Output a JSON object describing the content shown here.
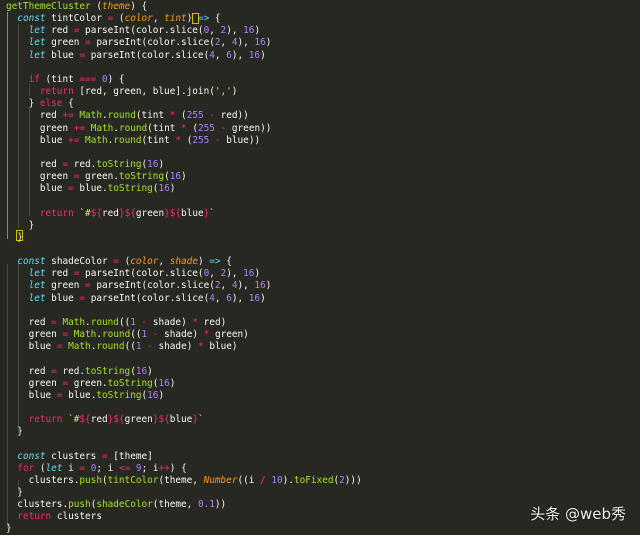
{
  "watermark": {
    "text": "头条 @web秀"
  },
  "code_lines": [
    [
      {
        "t": "fn",
        "v": "getThemeCluster"
      },
      {
        "t": "pun",
        "v": " ("
      },
      {
        "t": "par",
        "v": "theme"
      },
      {
        "t": "pun",
        "v": ") {"
      }
    ],
    [
      {
        "t": "sp",
        "v": "  "
      },
      {
        "t": "kw",
        "v": "const"
      },
      {
        "t": "var",
        "v": " tintColor "
      },
      {
        "t": "op",
        "v": "="
      },
      {
        "t": "pun",
        "v": " ("
      },
      {
        "t": "par",
        "v": "color"
      },
      {
        "t": "pun",
        "v": ", "
      },
      {
        "t": "par",
        "v": "tint"
      },
      {
        "t": "pun",
        "v": ") "
      },
      {
        "t": "kw",
        "v": "=>"
      },
      {
        "t": "pun",
        "v": " {"
      }
    ],
    [
      {
        "t": "sp",
        "v": "    "
      },
      {
        "t": "kw",
        "v": "let"
      },
      {
        "t": "var",
        "v": " red "
      },
      {
        "t": "op",
        "v": "="
      },
      {
        "t": "var",
        "v": " parseInt(color.slice("
      },
      {
        "t": "num",
        "v": "0"
      },
      {
        "t": "pun",
        "v": ", "
      },
      {
        "t": "num",
        "v": "2"
      },
      {
        "t": "pun",
        "v": "), "
      },
      {
        "t": "num",
        "v": "16"
      },
      {
        "t": "pun",
        "v": ")"
      }
    ],
    [
      {
        "t": "sp",
        "v": "    "
      },
      {
        "t": "kw",
        "v": "let"
      },
      {
        "t": "var",
        "v": " green "
      },
      {
        "t": "op",
        "v": "="
      },
      {
        "t": "var",
        "v": " parseInt(color.slice("
      },
      {
        "t": "num",
        "v": "2"
      },
      {
        "t": "pun",
        "v": ", "
      },
      {
        "t": "num",
        "v": "4"
      },
      {
        "t": "pun",
        "v": "), "
      },
      {
        "t": "num",
        "v": "16"
      },
      {
        "t": "pun",
        "v": ")"
      }
    ],
    [
      {
        "t": "sp",
        "v": "    "
      },
      {
        "t": "kw",
        "v": "let"
      },
      {
        "t": "var",
        "v": " blue "
      },
      {
        "t": "op",
        "v": "="
      },
      {
        "t": "var",
        "v": " parseInt(color.slice("
      },
      {
        "t": "num",
        "v": "4"
      },
      {
        "t": "pun",
        "v": ", "
      },
      {
        "t": "num",
        "v": "6"
      },
      {
        "t": "pun",
        "v": "), "
      },
      {
        "t": "num",
        "v": "16"
      },
      {
        "t": "pun",
        "v": ")"
      }
    ],
    [],
    [
      {
        "t": "sp",
        "v": "    "
      },
      {
        "t": "ct",
        "v": "if"
      },
      {
        "t": "pun",
        "v": " (tint "
      },
      {
        "t": "op",
        "v": "==="
      },
      {
        "t": "pun",
        "v": " "
      },
      {
        "t": "num",
        "v": "0"
      },
      {
        "t": "pun",
        "v": ") {"
      }
    ],
    [
      {
        "t": "sp",
        "v": "      "
      },
      {
        "t": "ct",
        "v": "return"
      },
      {
        "t": "pun",
        "v": " [red, green, blue].join("
      },
      {
        "t": "str",
        "v": "','"
      },
      {
        "t": "pun",
        "v": ")"
      }
    ],
    [
      {
        "t": "sp",
        "v": "    "
      },
      {
        "t": "pun",
        "v": "} "
      },
      {
        "t": "ct",
        "v": "else"
      },
      {
        "t": "pun",
        "v": " {"
      }
    ],
    [
      {
        "t": "sp",
        "v": "      "
      },
      {
        "t": "var",
        "v": "red "
      },
      {
        "t": "op",
        "v": "+="
      },
      {
        "t": "fn",
        "v": " Math"
      },
      {
        "t": "pun",
        "v": "."
      },
      {
        "t": "fn",
        "v": "round"
      },
      {
        "t": "pun",
        "v": "(tint "
      },
      {
        "t": "op",
        "v": "*"
      },
      {
        "t": "pun",
        "v": " ("
      },
      {
        "t": "num",
        "v": "255"
      },
      {
        "t": "pun",
        "v": " "
      },
      {
        "t": "op",
        "v": "-"
      },
      {
        "t": "pun",
        "v": " red))"
      }
    ],
    [
      {
        "t": "sp",
        "v": "      "
      },
      {
        "t": "var",
        "v": "green "
      },
      {
        "t": "op",
        "v": "+="
      },
      {
        "t": "fn",
        "v": " Math"
      },
      {
        "t": "pun",
        "v": "."
      },
      {
        "t": "fn",
        "v": "round"
      },
      {
        "t": "pun",
        "v": "(tint "
      },
      {
        "t": "op",
        "v": "*"
      },
      {
        "t": "pun",
        "v": " ("
      },
      {
        "t": "num",
        "v": "255"
      },
      {
        "t": "pun",
        "v": " "
      },
      {
        "t": "op",
        "v": "-"
      },
      {
        "t": "pun",
        "v": " green))"
      }
    ],
    [
      {
        "t": "sp",
        "v": "      "
      },
      {
        "t": "var",
        "v": "blue "
      },
      {
        "t": "op",
        "v": "+="
      },
      {
        "t": "fn",
        "v": " Math"
      },
      {
        "t": "pun",
        "v": "."
      },
      {
        "t": "fn",
        "v": "round"
      },
      {
        "t": "pun",
        "v": "(tint "
      },
      {
        "t": "op",
        "v": "*"
      },
      {
        "t": "pun",
        "v": " ("
      },
      {
        "t": "num",
        "v": "255"
      },
      {
        "t": "pun",
        "v": " "
      },
      {
        "t": "op",
        "v": "-"
      },
      {
        "t": "pun",
        "v": " blue))"
      }
    ],
    [],
    [
      {
        "t": "sp",
        "v": "      "
      },
      {
        "t": "var",
        "v": "red "
      },
      {
        "t": "op",
        "v": "="
      },
      {
        "t": "pun",
        "v": " red."
      },
      {
        "t": "fn",
        "v": "toString"
      },
      {
        "t": "pun",
        "v": "("
      },
      {
        "t": "num",
        "v": "16"
      },
      {
        "t": "pun",
        "v": ")"
      }
    ],
    [
      {
        "t": "sp",
        "v": "      "
      },
      {
        "t": "var",
        "v": "green "
      },
      {
        "t": "op",
        "v": "="
      },
      {
        "t": "pun",
        "v": " green."
      },
      {
        "t": "fn",
        "v": "toString"
      },
      {
        "t": "pun",
        "v": "("
      },
      {
        "t": "num",
        "v": "16"
      },
      {
        "t": "pun",
        "v": ")"
      }
    ],
    [
      {
        "t": "sp",
        "v": "      "
      },
      {
        "t": "var",
        "v": "blue "
      },
      {
        "t": "op",
        "v": "="
      },
      {
        "t": "pun",
        "v": " blue."
      },
      {
        "t": "fn",
        "v": "toString"
      },
      {
        "t": "pun",
        "v": "("
      },
      {
        "t": "num",
        "v": "16"
      },
      {
        "t": "pun",
        "v": ")"
      }
    ],
    [],
    [
      {
        "t": "sp",
        "v": "      "
      },
      {
        "t": "ct",
        "v": "return"
      },
      {
        "t": "pun",
        "v": " "
      },
      {
        "t": "tpl",
        "v": "`#"
      },
      {
        "t": "tpi",
        "v": "${"
      },
      {
        "t": "var",
        "v": "red"
      },
      {
        "t": "tpi",
        "v": "}${"
      },
      {
        "t": "var",
        "v": "green"
      },
      {
        "t": "tpi",
        "v": "}${"
      },
      {
        "t": "var",
        "v": "blue"
      },
      {
        "t": "tpi",
        "v": "}"
      },
      {
        "t": "tpl",
        "v": "`"
      }
    ],
    [
      {
        "t": "sp",
        "v": "    "
      },
      {
        "t": "pun",
        "v": "}"
      }
    ],
    [
      {
        "t": "sp",
        "v": "  "
      },
      {
        "t": "pun",
        "v": "}"
      }
    ],
    [],
    [
      {
        "t": "sp",
        "v": "  "
      },
      {
        "t": "kw",
        "v": "const"
      },
      {
        "t": "var",
        "v": " shadeColor "
      },
      {
        "t": "op",
        "v": "="
      },
      {
        "t": "pun",
        "v": " ("
      },
      {
        "t": "par",
        "v": "color"
      },
      {
        "t": "pun",
        "v": ", "
      },
      {
        "t": "par",
        "v": "shade"
      },
      {
        "t": "pun",
        "v": ") "
      },
      {
        "t": "kw",
        "v": "=>"
      },
      {
        "t": "pun",
        "v": " {"
      }
    ],
    [
      {
        "t": "sp",
        "v": "    "
      },
      {
        "t": "kw",
        "v": "let"
      },
      {
        "t": "var",
        "v": " red "
      },
      {
        "t": "op",
        "v": "="
      },
      {
        "t": "var",
        "v": " parseInt(color.slice("
      },
      {
        "t": "num",
        "v": "0"
      },
      {
        "t": "pun",
        "v": ", "
      },
      {
        "t": "num",
        "v": "2"
      },
      {
        "t": "pun",
        "v": "), "
      },
      {
        "t": "num",
        "v": "16"
      },
      {
        "t": "pun",
        "v": ")"
      }
    ],
    [
      {
        "t": "sp",
        "v": "    "
      },
      {
        "t": "kw",
        "v": "let"
      },
      {
        "t": "var",
        "v": " green "
      },
      {
        "t": "op",
        "v": "="
      },
      {
        "t": "var",
        "v": " parseInt(color.slice("
      },
      {
        "t": "num",
        "v": "2"
      },
      {
        "t": "pun",
        "v": ", "
      },
      {
        "t": "num",
        "v": "4"
      },
      {
        "t": "pun",
        "v": "), "
      },
      {
        "t": "num",
        "v": "16"
      },
      {
        "t": "pun",
        "v": ")"
      }
    ],
    [
      {
        "t": "sp",
        "v": "    "
      },
      {
        "t": "kw",
        "v": "let"
      },
      {
        "t": "var",
        "v": " blue "
      },
      {
        "t": "op",
        "v": "="
      },
      {
        "t": "var",
        "v": " parseInt(color.slice("
      },
      {
        "t": "num",
        "v": "4"
      },
      {
        "t": "pun",
        "v": ", "
      },
      {
        "t": "num",
        "v": "6"
      },
      {
        "t": "pun",
        "v": "), "
      },
      {
        "t": "num",
        "v": "16"
      },
      {
        "t": "pun",
        "v": ")"
      }
    ],
    [],
    [
      {
        "t": "sp",
        "v": "    "
      },
      {
        "t": "var",
        "v": "red "
      },
      {
        "t": "op",
        "v": "="
      },
      {
        "t": "fn",
        "v": " Math"
      },
      {
        "t": "pun",
        "v": "."
      },
      {
        "t": "fn",
        "v": "round"
      },
      {
        "t": "pun",
        "v": "(("
      },
      {
        "t": "num",
        "v": "1"
      },
      {
        "t": "pun",
        "v": " "
      },
      {
        "t": "op",
        "v": "-"
      },
      {
        "t": "pun",
        "v": " shade) "
      },
      {
        "t": "op",
        "v": "*"
      },
      {
        "t": "pun",
        "v": " red)"
      }
    ],
    [
      {
        "t": "sp",
        "v": "    "
      },
      {
        "t": "var",
        "v": "green "
      },
      {
        "t": "op",
        "v": "="
      },
      {
        "t": "fn",
        "v": " Math"
      },
      {
        "t": "pun",
        "v": "."
      },
      {
        "t": "fn",
        "v": "round"
      },
      {
        "t": "pun",
        "v": "(("
      },
      {
        "t": "num",
        "v": "1"
      },
      {
        "t": "pun",
        "v": " "
      },
      {
        "t": "op",
        "v": "-"
      },
      {
        "t": "pun",
        "v": " shade) "
      },
      {
        "t": "op",
        "v": "*"
      },
      {
        "t": "pun",
        "v": " green)"
      }
    ],
    [
      {
        "t": "sp",
        "v": "    "
      },
      {
        "t": "var",
        "v": "blue "
      },
      {
        "t": "op",
        "v": "="
      },
      {
        "t": "fn",
        "v": " Math"
      },
      {
        "t": "pun",
        "v": "."
      },
      {
        "t": "fn",
        "v": "round"
      },
      {
        "t": "pun",
        "v": "(("
      },
      {
        "t": "num",
        "v": "1"
      },
      {
        "t": "pun",
        "v": " "
      },
      {
        "t": "op",
        "v": "-"
      },
      {
        "t": "pun",
        "v": " shade) "
      },
      {
        "t": "op",
        "v": "*"
      },
      {
        "t": "pun",
        "v": " blue)"
      }
    ],
    [],
    [
      {
        "t": "sp",
        "v": "    "
      },
      {
        "t": "var",
        "v": "red "
      },
      {
        "t": "op",
        "v": "="
      },
      {
        "t": "pun",
        "v": " red."
      },
      {
        "t": "fn",
        "v": "toString"
      },
      {
        "t": "pun",
        "v": "("
      },
      {
        "t": "num",
        "v": "16"
      },
      {
        "t": "pun",
        "v": ")"
      }
    ],
    [
      {
        "t": "sp",
        "v": "    "
      },
      {
        "t": "var",
        "v": "green "
      },
      {
        "t": "op",
        "v": "="
      },
      {
        "t": "pun",
        "v": " green."
      },
      {
        "t": "fn",
        "v": "toString"
      },
      {
        "t": "pun",
        "v": "("
      },
      {
        "t": "num",
        "v": "16"
      },
      {
        "t": "pun",
        "v": ")"
      }
    ],
    [
      {
        "t": "sp",
        "v": "    "
      },
      {
        "t": "var",
        "v": "blue "
      },
      {
        "t": "op",
        "v": "="
      },
      {
        "t": "pun",
        "v": " blue."
      },
      {
        "t": "fn",
        "v": "toString"
      },
      {
        "t": "pun",
        "v": "("
      },
      {
        "t": "num",
        "v": "16"
      },
      {
        "t": "pun",
        "v": ")"
      }
    ],
    [],
    [
      {
        "t": "sp",
        "v": "    "
      },
      {
        "t": "ct",
        "v": "return"
      },
      {
        "t": "pun",
        "v": " "
      },
      {
        "t": "tpl",
        "v": "`#"
      },
      {
        "t": "tpi",
        "v": "${"
      },
      {
        "t": "var",
        "v": "red"
      },
      {
        "t": "tpi",
        "v": "}${"
      },
      {
        "t": "var",
        "v": "green"
      },
      {
        "t": "tpi",
        "v": "}${"
      },
      {
        "t": "var",
        "v": "blue"
      },
      {
        "t": "tpi",
        "v": "}"
      },
      {
        "t": "tpl",
        "v": "`"
      }
    ],
    [
      {
        "t": "sp",
        "v": "  "
      },
      {
        "t": "pun",
        "v": "}"
      }
    ],
    [],
    [
      {
        "t": "sp",
        "v": "  "
      },
      {
        "t": "kw",
        "v": "const"
      },
      {
        "t": "var",
        "v": " clusters "
      },
      {
        "t": "op",
        "v": "="
      },
      {
        "t": "pun",
        "v": " [theme]"
      }
    ],
    [
      {
        "t": "sp",
        "v": "  "
      },
      {
        "t": "ct",
        "v": "for"
      },
      {
        "t": "pun",
        "v": " ("
      },
      {
        "t": "kw",
        "v": "let"
      },
      {
        "t": "pun",
        "v": " i "
      },
      {
        "t": "op",
        "v": "="
      },
      {
        "t": "pun",
        "v": " "
      },
      {
        "t": "num",
        "v": "0"
      },
      {
        "t": "pun",
        "v": "; i "
      },
      {
        "t": "op",
        "v": "<="
      },
      {
        "t": "pun",
        "v": " "
      },
      {
        "t": "num",
        "v": "9"
      },
      {
        "t": "pun",
        "v": "; i"
      },
      {
        "t": "op",
        "v": "++"
      },
      {
        "t": "pun",
        "v": ") {"
      }
    ],
    [
      {
        "t": "sp",
        "v": "    "
      },
      {
        "t": "var",
        "v": "clusters."
      },
      {
        "t": "fn",
        "v": "push"
      },
      {
        "t": "pun",
        "v": "("
      },
      {
        "t": "fn",
        "v": "tintColor"
      },
      {
        "t": "pun",
        "v": "(theme, "
      },
      {
        "t": "par",
        "v": "Number"
      },
      {
        "t": "pun",
        "v": "((i "
      },
      {
        "t": "op",
        "v": "/"
      },
      {
        "t": "pun",
        "v": " "
      },
      {
        "t": "num",
        "v": "10"
      },
      {
        "t": "pun",
        "v": ")."
      },
      {
        "t": "fn",
        "v": "toFixed"
      },
      {
        "t": "pun",
        "v": "("
      },
      {
        "t": "num",
        "v": "2"
      },
      {
        "t": "pun",
        "v": ")))"
      }
    ],
    [
      {
        "t": "sp",
        "v": "  "
      },
      {
        "t": "pun",
        "v": "}"
      }
    ],
    [
      {
        "t": "sp",
        "v": "  "
      },
      {
        "t": "var",
        "v": "clusters."
      },
      {
        "t": "fn",
        "v": "push"
      },
      {
        "t": "pun",
        "v": "("
      },
      {
        "t": "fn",
        "v": "shadeColor"
      },
      {
        "t": "pun",
        "v": "(theme, "
      },
      {
        "t": "num",
        "v": "0.1"
      },
      {
        "t": "pun",
        "v": "))"
      }
    ],
    [
      {
        "t": "sp",
        "v": "  "
      },
      {
        "t": "ct",
        "v": "return"
      },
      {
        "t": "var",
        "v": " clusters"
      }
    ],
    [
      {
        "t": "pun",
        "v": "}"
      }
    ]
  ]
}
